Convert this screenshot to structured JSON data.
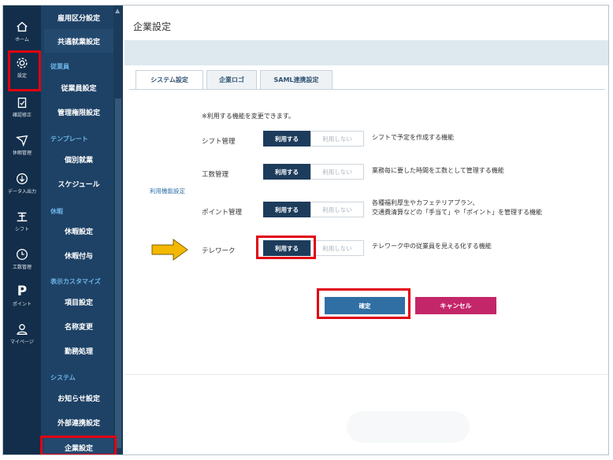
{
  "rail": {
    "items": [
      {
        "label": "ホーム",
        "icon": "home-icon"
      },
      {
        "label": "設定",
        "icon": "gear-icon"
      },
      {
        "label": "確認修正",
        "icon": "clipboard-icon"
      },
      {
        "label": "休暇管理",
        "icon": "airplane-icon"
      },
      {
        "label": "データ入出力",
        "icon": "download-icon"
      },
      {
        "label": "シフト",
        "icon": "shift-icon"
      },
      {
        "label": "工数管理",
        "icon": "clock-icon"
      },
      {
        "label": "ポイント",
        "icon": "point-icon",
        "glyph": "P"
      },
      {
        "label": "マイページ",
        "icon": "user-icon"
      }
    ]
  },
  "menu": {
    "items": [
      {
        "label": "雇用区分設定"
      },
      {
        "label": "共通就業設定"
      },
      {
        "heading": "従業員"
      },
      {
        "label": "従業員設定"
      },
      {
        "label": "管理権限設定"
      },
      {
        "heading": "テンプレート"
      },
      {
        "label": "個別就業"
      },
      {
        "label": "スケジュール"
      },
      {
        "heading": "休暇"
      },
      {
        "label": "休暇設定"
      },
      {
        "label": "休暇付与"
      },
      {
        "heading": "表示カスタマイズ"
      },
      {
        "label": "項目設定"
      },
      {
        "label": "名称変更"
      },
      {
        "label": "勤務処理"
      },
      {
        "heading": "システム"
      },
      {
        "label": "お知らせ設定"
      },
      {
        "label": "外部連携設定"
      },
      {
        "label": "企業設定"
      }
    ]
  },
  "page": {
    "title": "企業設定"
  },
  "tabs": [
    {
      "label": "システム設定",
      "active": true
    },
    {
      "label": "企業ロゴ",
      "active": false
    },
    {
      "label": "SAML連携設定",
      "active": false
    }
  ],
  "settings": {
    "note": "※利用する機能を変更できます。",
    "group_label": "利用機能設定",
    "on_label": "利用する",
    "off_label": "利用しない",
    "features": [
      {
        "name": "シフト管理",
        "desc": "シフトで予定を作成する機能",
        "enabled": true
      },
      {
        "name": "工数管理",
        "desc": "業務毎に要した時間を工数として管理する機能",
        "enabled": true
      },
      {
        "name": "ポイント管理",
        "desc": "各種福利厚生やカフェテリアプラン、\n交通費清算などの「手当て」や「ポイント」を管理する機能",
        "enabled": true
      },
      {
        "name": "テレワーク",
        "desc": "テレワーク中の従業員を見える化する機能",
        "enabled": true
      }
    ]
  },
  "buttons": {
    "confirm": "確定",
    "cancel": "キャンセル"
  },
  "colors": {
    "highlight": "#e10010",
    "arrow": "#f5b800",
    "toggle_on": "#1d3c5c",
    "cancel": "#c4266a",
    "confirm": "#2f6fa4"
  }
}
